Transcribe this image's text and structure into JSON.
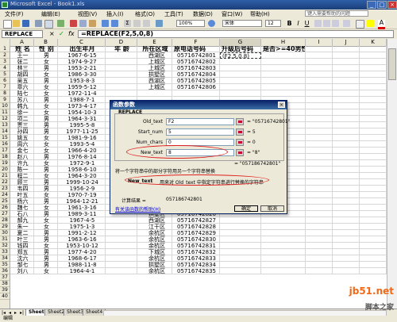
{
  "window": {
    "title": "Microsoft Excel - Book1.xls"
  },
  "menu": {
    "items": [
      "文件(F)",
      "编辑(E)",
      "视图(V)",
      "插入(I)",
      "格式(O)",
      "工具(T)",
      "数据(D)",
      "窗口(W)",
      "帮助(H)"
    ],
    "help_placeholder": "键入需要帮助的问题"
  },
  "toolbar": {
    "zoom": "100%",
    "font_name": "宋体",
    "font_size": "12"
  },
  "formula_bar": {
    "name_box": "REPLACE",
    "formula": "=REPLACE(F2,5,0,8)"
  },
  "columns": [
    "A",
    "B",
    "C",
    "D",
    "E",
    "F",
    "G",
    "H",
    "I",
    "J",
    "K"
  ],
  "headers": [
    "姓 名",
    "性 别",
    "出生年月",
    "年 龄",
    "所在区域",
    "原电话号码",
    "升级后号码",
    "是否>=40男性"
  ],
  "rows": [
    [
      "王一",
      "男",
      "1967-6-15",
      "",
      "西湖区",
      "05716742801",
      "(F2,5,0,8)",
      ""
    ],
    [
      "张二",
      "女",
      "1974-9-27",
      "",
      "上城区",
      "05716742802",
      "",
      ""
    ],
    [
      "林三",
      "男",
      "1953-2-21",
      "",
      "上城区",
      "05716742803",
      "",
      ""
    ],
    [
      "胡四",
      "女",
      "1986-3-30",
      "",
      "拱墅区",
      "05716742804",
      "",
      ""
    ],
    [
      "吴五",
      "男",
      "1953-8-3",
      "",
      "西湖区",
      "05716742805",
      "",
      ""
    ],
    [
      "章六",
      "女",
      "1959-5-12",
      "",
      "上城区",
      "05716742806",
      "",
      ""
    ],
    [
      "陆七",
      "女",
      "1972-11-4",
      "",
      "",
      "",
      "",
      ""
    ],
    [
      "苏八",
      "男",
      "1988-7-1",
      "",
      "",
      "",
      "",
      ""
    ],
    [
      "韩九",
      "女",
      "1973-4-17",
      "",
      "",
      "",
      "",
      ""
    ],
    [
      "徐一",
      "女",
      "1954-10-3",
      "",
      "",
      "",
      "",
      ""
    ],
    [
      "项二",
      "男",
      "1964-3-31",
      "",
      "",
      "",
      "",
      ""
    ],
    [
      "贾三",
      "男",
      "1995-5-8",
      "",
      "",
      "",
      "",
      ""
    ],
    [
      "孙四",
      "男",
      "1977-11-25",
      "",
      "",
      "",
      "",
      ""
    ],
    [
      "姚五",
      "女",
      "1981-9-16",
      "",
      "",
      "",
      "",
      ""
    ],
    [
      "周六",
      "女",
      "1993-5-4",
      "",
      "",
      "",
      "",
      ""
    ],
    [
      "金七",
      "女",
      "1966-4-20",
      "",
      "",
      "",
      "",
      ""
    ],
    [
      "赵八",
      "男",
      "1976-8-14",
      "",
      "",
      "",
      "",
      ""
    ],
    [
      "许九",
      "女",
      "1972-9-1",
      "",
      "",
      "",
      "",
      ""
    ],
    [
      "陈一",
      "男",
      "1958-6-10",
      "",
      "",
      "",
      "",
      ""
    ],
    [
      "程二",
      "女",
      "1964-3-20",
      "",
      "",
      "",
      "",
      ""
    ],
    [
      "顾三",
      "男",
      "1999-10-24",
      "",
      "",
      "",
      "",
      ""
    ],
    [
      "韦四",
      "男",
      "1956-2-9",
      "",
      "",
      "",
      "",
      ""
    ],
    [
      "叶五",
      "女",
      "1970-7-19",
      "",
      "",
      "",
      "",
      ""
    ],
    [
      "杨六",
      "男",
      "1964-12-21",
      "",
      "余杭区",
      "05716742824",
      "",
      ""
    ],
    [
      "魏七",
      "女",
      "1961-3-16",
      "",
      "上城区",
      "05716742825",
      "",
      ""
    ],
    [
      "石八",
      "男",
      "1989-3-11",
      "",
      "拱墅区",
      "05716742826",
      "",
      ""
    ],
    [
      "郝九",
      "女",
      "1967-4-5",
      "",
      "西湖区",
      "05716742827",
      "",
      ""
    ],
    [
      "朱一",
      "女",
      "1975-1-3",
      "",
      "江干区",
      "05716742828",
      "",
      ""
    ],
    [
      "夏二",
      "男",
      "1991-2-12",
      "",
      "余杭区",
      "05716742829",
      "",
      ""
    ],
    [
      "叶三",
      "男",
      "1963-6-16",
      "",
      "余杭区",
      "05716742830",
      "",
      ""
    ],
    [
      "钱四",
      "女",
      "1953-10-12",
      "",
      "余杭区",
      "05716742831",
      "",
      ""
    ],
    [
      "郑五",
      "男",
      "1977-4-20",
      "",
      "下城区",
      "05716742832",
      "",
      ""
    ],
    [
      "沈六",
      "男",
      "1968-6-17",
      "",
      "余杭区",
      "05716742833",
      "",
      ""
    ],
    [
      "邹七",
      "男",
      "1988-11-8",
      "",
      "拱墅区",
      "05716742834",
      "",
      ""
    ],
    [
      "刘八",
      "女",
      "1964-4-1",
      "",
      "余杭区",
      "05716742835",
      "",
      ""
    ]
  ],
  "row_numbers": [
    "1",
    "2",
    "3",
    "4",
    "5",
    "6",
    "7",
    "8",
    "9",
    "10",
    "11",
    "12",
    "13",
    "14",
    "15",
    "16",
    "17",
    "18",
    "19",
    "20",
    "21",
    "22",
    "23",
    "24",
    "25",
    "26",
    "27",
    "28",
    "29",
    "30",
    "31",
    "32",
    "33",
    "34",
    "35",
    "36",
    "37",
    "38",
    "39",
    "40"
  ],
  "dialog": {
    "title": "函数参数",
    "function_name": "REPLACE",
    "args": [
      {
        "label": "Old_text",
        "value": "F2",
        "result": "= \"05716742801\""
      },
      {
        "label": "Start_num",
        "value": "5",
        "result": "= 5"
      },
      {
        "label": "Num_chars",
        "value": "0",
        "result": "= 0"
      },
      {
        "label": "New_text",
        "value": "8",
        "result": "= \"8\""
      }
    ],
    "formula_result_preview": "= \"057186742801\"",
    "description": "将一个字符串中的部分字符用另一个字符串替换",
    "arg_help_name": "New_text",
    "arg_help": "用来对 Old_text 中指定字符串进行替换的字符串",
    "calc_result_label": "计算结果 =",
    "calc_result_value": "057186742801",
    "help_link": "有关该函数的帮助(H)",
    "ok": "确定",
    "cancel": "取消"
  },
  "sheets": [
    "Sheet1",
    "Sheet2",
    "Sheet3",
    "Sheet4"
  ],
  "status": "编辑",
  "watermark": {
    "line1": "jb51.net",
    "line2": "脚本之家"
  }
}
